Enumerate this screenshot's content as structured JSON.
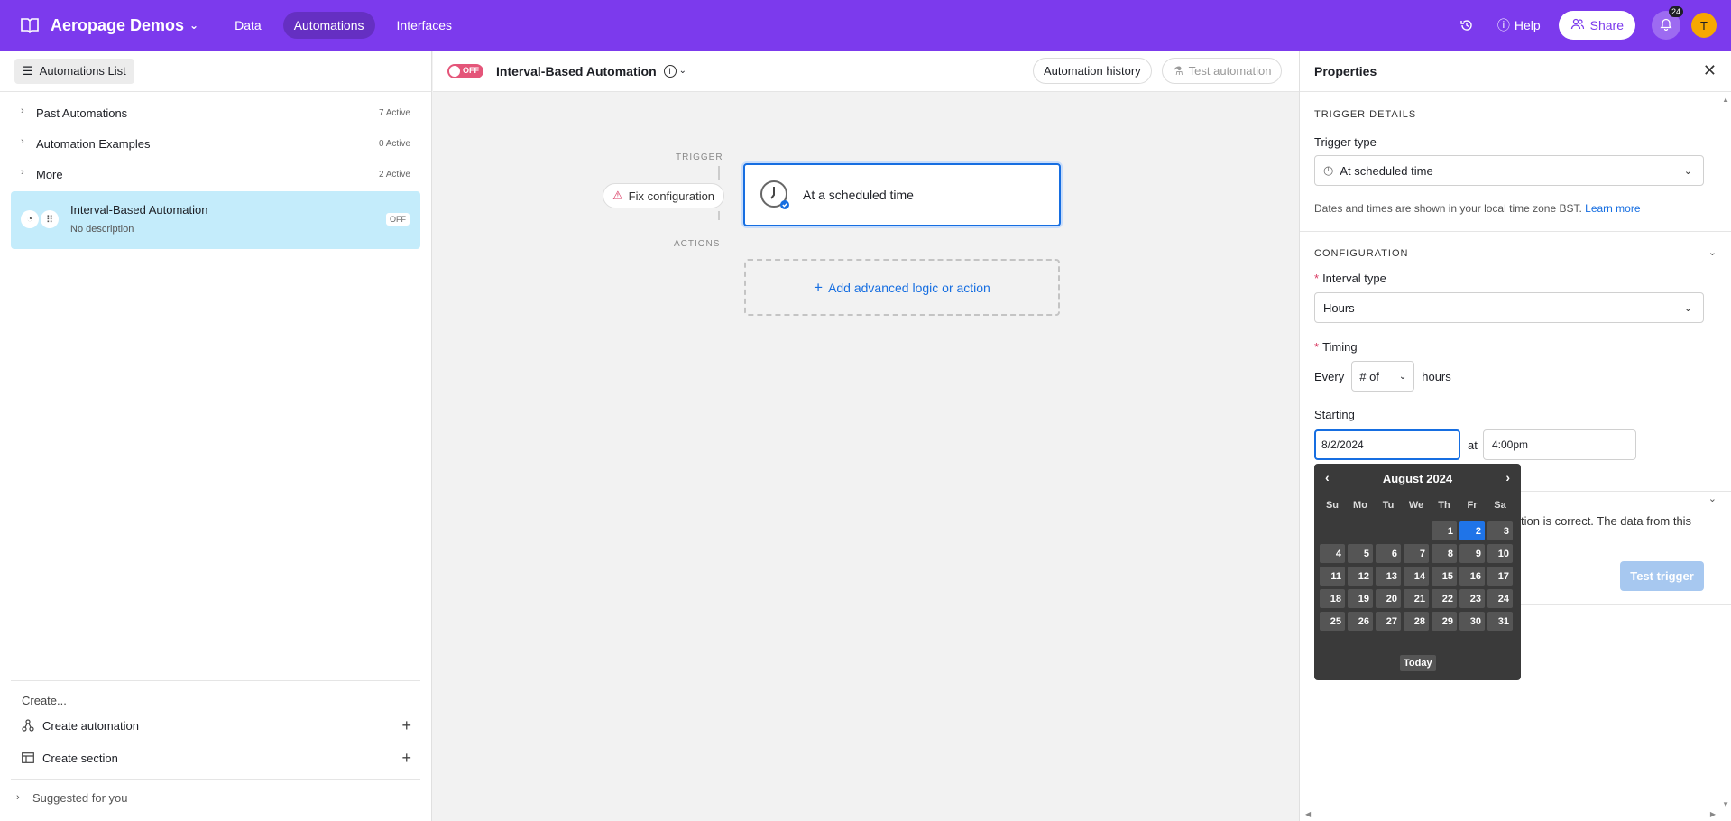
{
  "topbar": {
    "base_name": "Aeropage Demos",
    "tabs": [
      "Data",
      "Automations",
      "Interfaces"
    ],
    "help_label": "Help",
    "share_label": "Share",
    "notifications_count": "24",
    "avatar_initial": "T",
    "brand_color": "#7c3aed"
  },
  "sidebar": {
    "header_button": "Automations List",
    "sections": [
      {
        "label": "Past Automations",
        "count": "7 Active"
      },
      {
        "label": "Automation Examples",
        "count": "0 Active"
      },
      {
        "label": "More",
        "count": "2 Active"
      }
    ],
    "selected_item": {
      "title": "Interval-Based Automation",
      "description": "No description",
      "status": "OFF"
    },
    "create_label": "Create...",
    "create_automation": "Create automation",
    "create_section": "Create section",
    "suggested": "Suggested for you"
  },
  "center": {
    "toggle_label": "OFF",
    "automation_name": "Interval-Based Automation",
    "history_button": "Automation history",
    "test_button": "Test automation",
    "trigger_label": "TRIGGER",
    "actions_label": "ACTIONS",
    "fix_button": "Fix configuration",
    "trigger_card_title": "At a scheduled time",
    "add_action": "Add advanced logic or action"
  },
  "properties": {
    "title": "Properties",
    "trigger_details": "TRIGGER DETAILS",
    "trigger_type_label": "Trigger type",
    "trigger_type_value": "At scheduled time",
    "timezone_note": "Dates and times are shown in your local time zone BST.",
    "learn_more": "Learn more",
    "configuration": "CONFIGURATION",
    "interval_type_label": "Interval type",
    "interval_type_value": "Hours",
    "timing_label": "Timing",
    "every": "Every",
    "number_placeholder": "# of",
    "hours": "hours",
    "starting_label": "Starting",
    "date_value": "8/2/2024",
    "at": "at",
    "time_value": "4:00pm",
    "partial_note": "tion is correct. The data from this",
    "test_trigger": "Test trigger"
  },
  "calendar": {
    "month_label": "August 2024",
    "weekdays": [
      "Su",
      "Mo",
      "Tu",
      "We",
      "Th",
      "Fr",
      "Sa"
    ],
    "leading_blanks": 4,
    "days_in_month": 31,
    "selected_day": 2,
    "today_label": "Today"
  }
}
